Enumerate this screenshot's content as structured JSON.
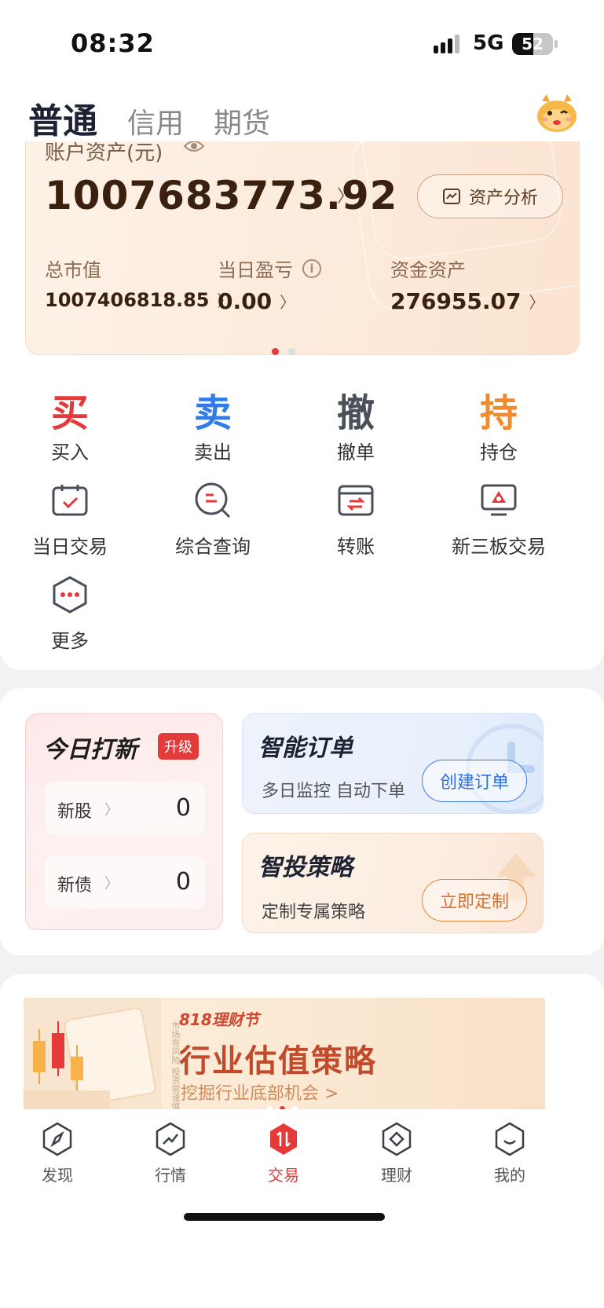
{
  "status_bar": {
    "time": "08:32",
    "network": "5G",
    "battery": "52",
    "battery_level": 0.52
  },
  "header": {
    "tabs": [
      {
        "label": "普通",
        "active": true
      },
      {
        "label": "信用",
        "active": false
      },
      {
        "label": "期货",
        "active": false
      }
    ],
    "mascot_icon": "mascot-avatar-icon"
  },
  "asset_card": {
    "label": "账户资产(元)",
    "total": "1007683773.92",
    "analyze_button": "资产分析",
    "metrics": [
      {
        "label": "总市值",
        "value": "1007406818.85"
      },
      {
        "label": "当日盈亏",
        "value": "0.00"
      },
      {
        "label": "资金资产",
        "value": "276955.07"
      }
    ],
    "page_dots": 2,
    "active_dot": 0
  },
  "grid": {
    "row1": [
      {
        "char": "买",
        "label": "买入",
        "color": "#e6393a"
      },
      {
        "char": "卖",
        "label": "卖出",
        "color": "#2f7be8"
      },
      {
        "char": "撤",
        "label": "撤单",
        "color": "#4a4f5a"
      },
      {
        "char": "持",
        "label": "持仓",
        "color": "#f08a2c"
      }
    ],
    "row2": [
      {
        "icon": "calendar-check-icon",
        "label": "当日交易"
      },
      {
        "icon": "search-query-icon",
        "label": "综合查询"
      },
      {
        "icon": "transfer-icon",
        "label": "转账"
      },
      {
        "icon": "monitor-icon",
        "label": "新三板交易"
      }
    ],
    "row3": [
      {
        "icon": "more-dots-icon",
        "label": "更多"
      }
    ]
  },
  "ipo": {
    "title": "今日打新",
    "badge": "升级",
    "rows": [
      {
        "name": "新股",
        "value": "0"
      },
      {
        "name": "新债",
        "value": "0"
      }
    ]
  },
  "smart_order": {
    "title": "智能订单",
    "subtitle": "多日监控 自动下单",
    "button": "创建订单"
  },
  "strategy": {
    "title": "智投策略",
    "subtitle": "定制专属策略",
    "button": "立即定制"
  },
  "banner": {
    "tag": "818理财节",
    "title": "行业估值策略",
    "subtitle": "挖掘行业底部机会 >",
    "side_text": "市场有风险 投资需谨慎"
  },
  "tabbar": [
    {
      "label": "发现",
      "icon": "compass-icon",
      "active": false
    },
    {
      "label": "行情",
      "icon": "trend-icon",
      "active": false
    },
    {
      "label": "交易",
      "icon": "trade-icon",
      "active": true
    },
    {
      "label": "理财",
      "icon": "diamond-icon",
      "active": false
    },
    {
      "label": "我的",
      "icon": "profile-icon",
      "active": false
    }
  ]
}
